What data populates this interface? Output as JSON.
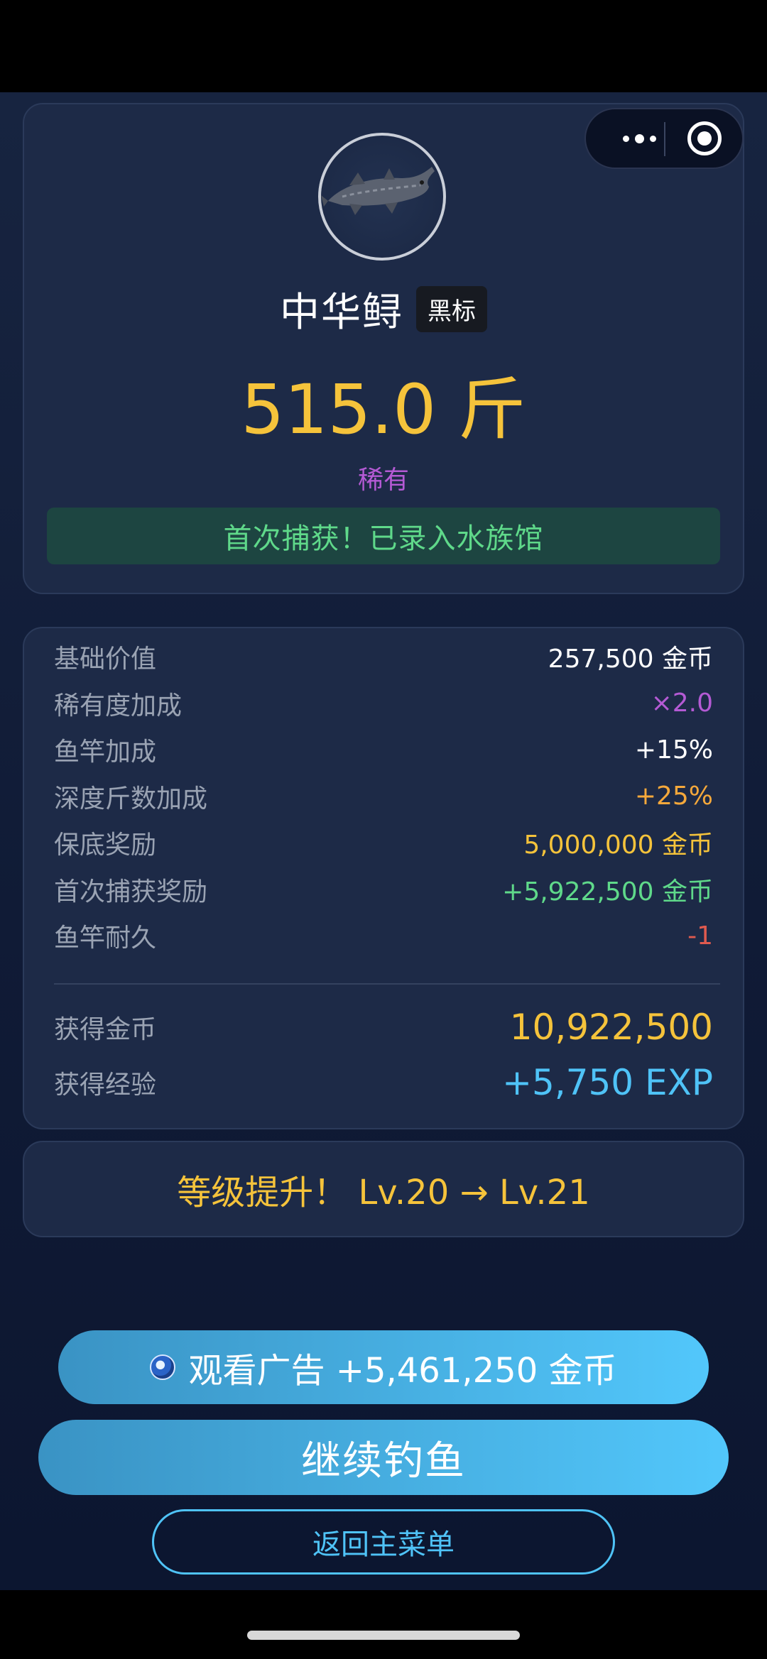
{
  "colors": {
    "gold": "#f5c33b",
    "purple": "#b45ad4",
    "green": "#5fd98a",
    "red": "#e05a4f",
    "blue": "#4fc3f7",
    "white": "#ffffff"
  },
  "catch": {
    "fish_name": "中华鲟",
    "tag": "黑标",
    "weight": "515.0 斤",
    "rarity": "稀有",
    "first_catch_banner": "首次捕获！已录入水族馆",
    "avatar_icon": "sturgeon-fish-icon"
  },
  "stats": [
    {
      "label": "基础价值",
      "value": "257,500 金币",
      "color": "#ffffff"
    },
    {
      "label": "稀有度加成",
      "value": "×2.0",
      "color": "#b45ad4"
    },
    {
      "label": "鱼竿加成",
      "value": "+15%",
      "color": "#ffffff"
    },
    {
      "label": "深度斤数加成",
      "value": "+25%",
      "color": "#f5a83b"
    },
    {
      "label": "保底奖励",
      "value": "5,000,000 金币",
      "color": "#f5c33b"
    },
    {
      "label": "首次捕获奖励",
      "value": "+5,922,500 金币",
      "color": "#5fd98a"
    },
    {
      "label": "鱼竿耐久",
      "value": "-1",
      "color": "#e05a4f"
    }
  ],
  "totals": {
    "coins_label": "获得金币",
    "coins_value": "10,922,500",
    "exp_label": "获得经验",
    "exp_value": "+5,750 EXP"
  },
  "level_up": "等级提升！ Lv.20 → Lv.21",
  "buttons": {
    "ad": "观看广告 +5,461,250 金币",
    "continue": "继续钓鱼",
    "menu": "返回主菜单"
  }
}
